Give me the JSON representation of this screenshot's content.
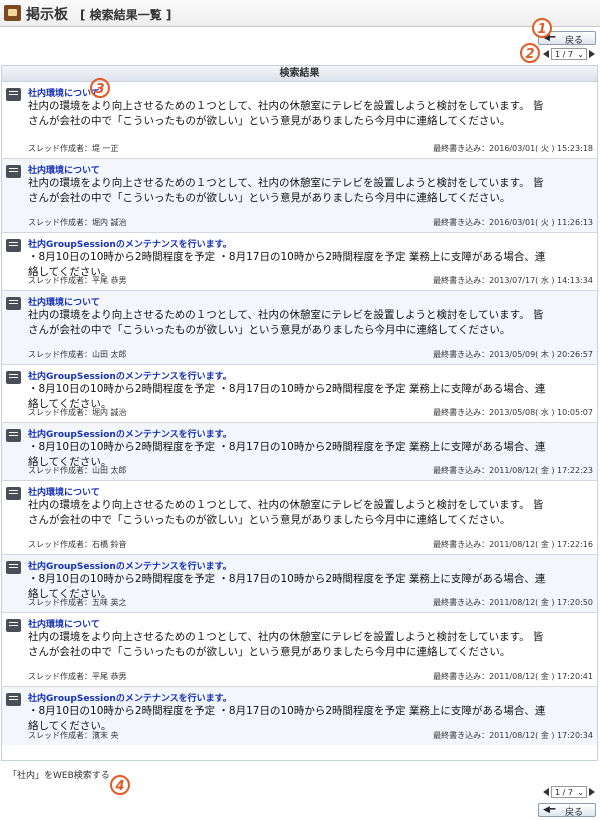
{
  "header": {
    "title": "掲示板",
    "subtitle": "[ 検索結果一覧 ]"
  },
  "toolbar": {
    "back_label": "戻る",
    "pager_value": "1 / 7"
  },
  "markers": [
    "1",
    "2",
    "3",
    "4"
  ],
  "results": {
    "header": "検索結果",
    "items": [
      {
        "title": "社内環境について",
        "body": "社内の環境をより向上させるための１つとして、社内の休憩室にテレビを設置しようと検討をしています。 皆さんが会社の中で「こういったものが欲しい」という意見がありましたら今月中に連絡してください。",
        "author": "スレッド作成者：堤 一正",
        "lastpost": "最終書き込み：2016/03/01( 火 ) 15:23:18"
      },
      {
        "title": "社内環境について",
        "body": "社内の環境をより向上させるための１つとして、社内の休憩室にテレビを設置しようと検討をしています。 皆さんが会社の中で「こういったものが欲しい」という意見がありましたら今月中に連絡してください。",
        "author": "スレッド作成者：堀内 誠治",
        "lastpost": "最終書き込み：2016/03/01( 火 ) 11:26:13"
      },
      {
        "title": "社内GroupSessionのメンテナンスを行います。",
        "body": "・8月10日の10時から2時間程度を予定 ・8月17日の10時から2時間程度を予定 業務上に支障がある場合、連絡してください。",
        "author": "スレッド作成者：平尾 恭男",
        "lastpost": "最終書き込み：2013/07/17( 水 ) 14:13:34"
      },
      {
        "title": "社内環境について",
        "body": "社内の環境をより向上させるための１つとして、社内の休憩室にテレビを設置しようと検討をしています。 皆さんが会社の中で「こういったものが欲しい」という意見がありましたら今月中に連絡してください。",
        "author": "スレッド作成者：山田 太郎",
        "lastpost": "最終書き込み：2013/05/09( 木 ) 20:26:57"
      },
      {
        "title": "社内GroupSessionのメンテナンスを行います。",
        "body": "・8月10日の10時から2時間程度を予定 ・8月17日の10時から2時間程度を予定 業務上に支障がある場合、連絡してください。",
        "author": "スレッド作成者：堀内 誠治",
        "lastpost": "最終書き込み：2013/05/08( 水 ) 10:05:07"
      },
      {
        "title": "社内GroupSessionのメンテナンスを行います。",
        "body": "・8月10日の10時から2時間程度を予定 ・8月17日の10時から2時間程度を予定 業務上に支障がある場合、連絡してください。",
        "author": "スレッド作成者：山田 太郎",
        "lastpost": "最終書き込み：2011/08/12( 金 ) 17:22:23"
      },
      {
        "title": "社内環境について",
        "body": "社内の環境をより向上させるための１つとして、社内の休憩室にテレビを設置しようと検討をしています。 皆さんが会社の中で「こういったものが欲しい」という意見がありましたら今月中に連絡してください。",
        "author": "スレッド作成者：石橋 鈴音",
        "lastpost": "最終書き込み：2011/08/12( 金 ) 17:22:16"
      },
      {
        "title": "社内GroupSessionのメンテナンスを行います。",
        "body": "・8月10日の10時から2時間程度を予定 ・8月17日の10時から2時間程度を予定 業務上に支障がある場合、連絡してください。",
        "author": "スレッド作成者：五味 英之",
        "lastpost": "最終書き込み：2011/08/12( 金 ) 17:20:50"
      },
      {
        "title": "社内環境について",
        "body": "社内の環境をより向上させるための１つとして、社内の休憩室にテレビを設置しようと検討をしています。 皆さんが会社の中で「こういったものが欲しい」という意見がありましたら今月中に連絡してください。",
        "author": "スレッド作成者：平尾 恭男",
        "lastpost": "最終書き込み：2011/08/12( 金 ) 17:20:41"
      },
      {
        "title": "社内GroupSessionのメンテナンスを行います。",
        "body": "・8月10日の10時から2時間程度を予定 ・8月17日の10時から2時間程度を予定 業務上に支障がある場合、連絡してください。",
        "author": "スレッド作成者：濱末 央",
        "lastpost": "最終書き込み：2011/08/12( 金 ) 17:20:34"
      }
    ]
  },
  "footer": {
    "web_search": "「社内」をWEB検索する"
  }
}
